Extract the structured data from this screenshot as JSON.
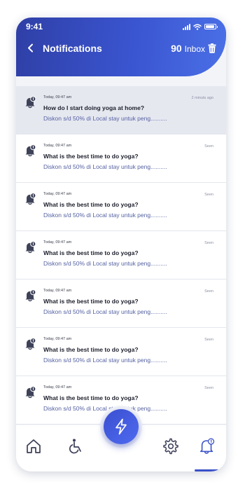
{
  "status_bar": {
    "time": "9:41"
  },
  "header": {
    "title": "Notifications",
    "inbox_count": "90",
    "inbox_label": "Inbox",
    "back_icon": "chevron-left-icon",
    "delete_icon": "trash-icon"
  },
  "notifications": [
    {
      "meta": "Today, 09:47 am",
      "status": "2 minuts ago",
      "title": "How do I start doing yoga at home?",
      "body": "Diskon s/d 50% di Local stay untuk peng..........",
      "unread": true
    },
    {
      "meta": "Today, 09:47 am",
      "status": "Seen",
      "title": "What is the best time to do yoga?",
      "body": "Diskon s/d 50% di Local stay untuk peng..........",
      "unread": false
    },
    {
      "meta": "Today, 09:47 am",
      "status": "Seen",
      "title": "What is the best time to do yoga?",
      "body": "Diskon s/d 50% di Local stay untuk peng..........",
      "unread": false
    },
    {
      "meta": "Today, 09:47 am",
      "status": "Seen",
      "title": "What is the best time to do yoga?",
      "body": "Diskon s/d 50% di Local stay untuk peng..........",
      "unread": false
    },
    {
      "meta": "Today, 09:47 am",
      "status": "Seen",
      "title": "What is the best time to do yoga?",
      "body": "Diskon s/d 50% di Local stay untuk peng..........",
      "unread": false
    },
    {
      "meta": "Today, 09:47 am",
      "status": "Seen",
      "title": "What is the best time to do yoga?",
      "body": "Diskon s/d 50% di Local stay untuk peng..........",
      "unread": false
    },
    {
      "meta": "Today, 09:47 am",
      "status": "Seen",
      "title": "What is the best time to do yoga?",
      "body": "Diskon s/d 50% di Local stay untuk peng..........",
      "unread": false
    }
  ],
  "bottom_nav": {
    "items": [
      "home-icon",
      "wheelchair-icon",
      "lightning-icon",
      "gear-icon",
      "bell-icon"
    ],
    "active": "bell-icon"
  },
  "colors": {
    "accent": "#3a50c8",
    "header_gradient_start": "#2f3fa6",
    "header_gradient_end": "#4a6fe6",
    "unread_background": "#e6e8f0",
    "body_text": "#5561a3"
  }
}
